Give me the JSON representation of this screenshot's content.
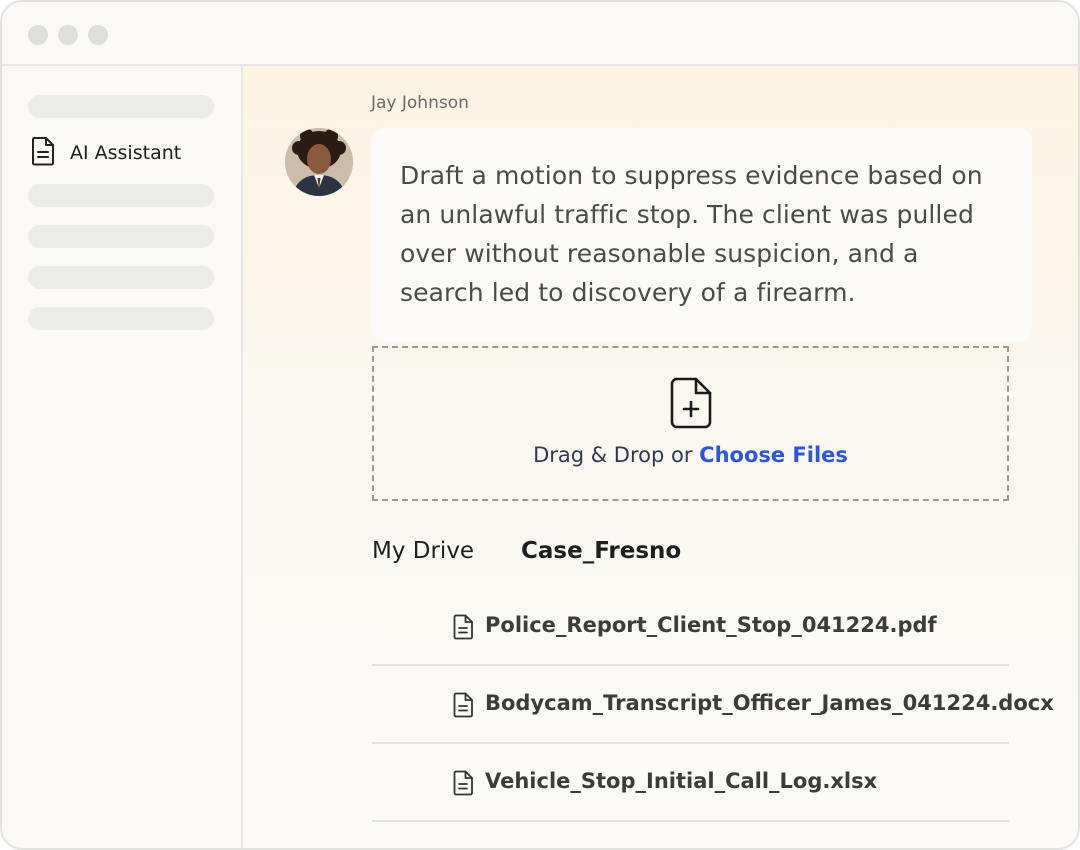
{
  "sidebar": {
    "active_item": {
      "label": "AI Assistant",
      "icon": "document-icon"
    }
  },
  "chat": {
    "sender_name": "Jay Johnson",
    "message": "Draft a motion to suppress evidence based on an unlawful traffic stop. The client was pulled over without reasonable suspicion, and a search led to discovery of a firearm."
  },
  "upload": {
    "icon": "file-plus-icon",
    "prompt_text": "Drag & Drop or ",
    "link_text": "Choose Files",
    "link_color": "#2a55e5"
  },
  "drive": {
    "tabs": [
      {
        "label": "My Drive"
      },
      {
        "label": "Case_Fresno"
      }
    ],
    "active_tab": "Case_Fresno",
    "files": [
      {
        "name": "Police_Report_Client_Stop_041224.pdf",
        "icon": "document-icon"
      },
      {
        "name": "Bodycam_Transcript_Officer_James_041224.docx",
        "icon": "document-icon"
      },
      {
        "name": "Vehicle_Stop_Initial_Call_Log.xlsx",
        "icon": "document-icon"
      }
    ]
  }
}
